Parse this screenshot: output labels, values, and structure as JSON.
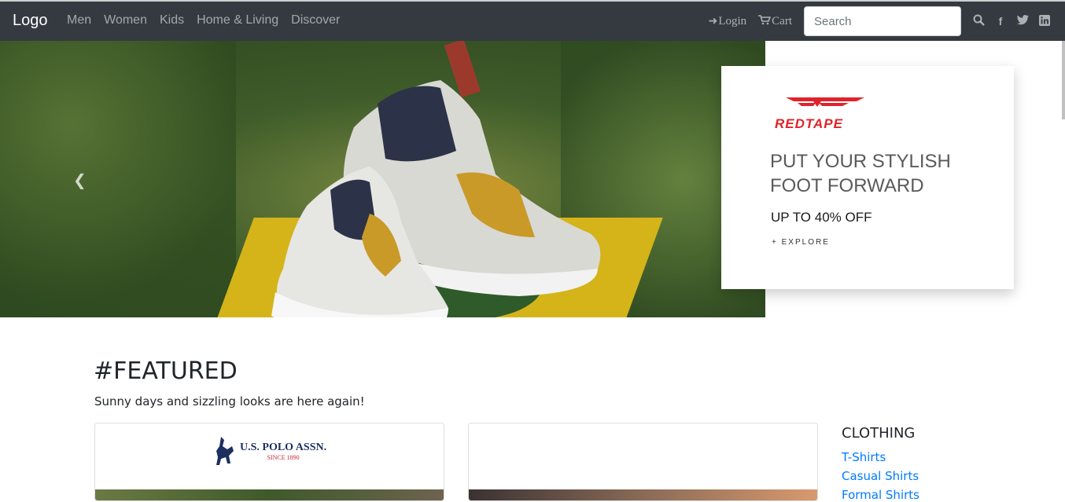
{
  "navbar": {
    "brand": "Logo",
    "links": [
      "Men",
      "Women",
      "Kids",
      "Home & Living",
      "Discover"
    ],
    "login_label": "Login",
    "cart_label": "Cart",
    "search_placeholder": "Search"
  },
  "hero": {
    "brand_name": "REDTAPE",
    "headline_1": "PUT YOUR STYLISH",
    "headline_2": "FOOT FORWARD",
    "offer": "UP TO 40% OFF",
    "explore": "+ EXPLORE"
  },
  "featured": {
    "title": "#FEATURED",
    "subtitle": "Sunny days and sizzling looks are here again!",
    "card1_brand": "U.S. POLO ASSN.",
    "card1_since": "SINCE 1890"
  },
  "sidebar": {
    "title": "CLOTHING",
    "links": [
      "T-Shirts",
      "Casual Shirts",
      "Formal Shirts"
    ]
  },
  "colors": {
    "navbar_bg": "#343a40",
    "link_color": "#007bff",
    "brand_red": "#e0232b"
  },
  "icons": {
    "login": "sign-in-icon",
    "cart": "cart-icon",
    "search": "search-icon",
    "facebook": "facebook-icon",
    "twitter": "twitter-icon",
    "linkedin": "linkedin-icon",
    "carousel_prev": "chevron-left-icon"
  }
}
